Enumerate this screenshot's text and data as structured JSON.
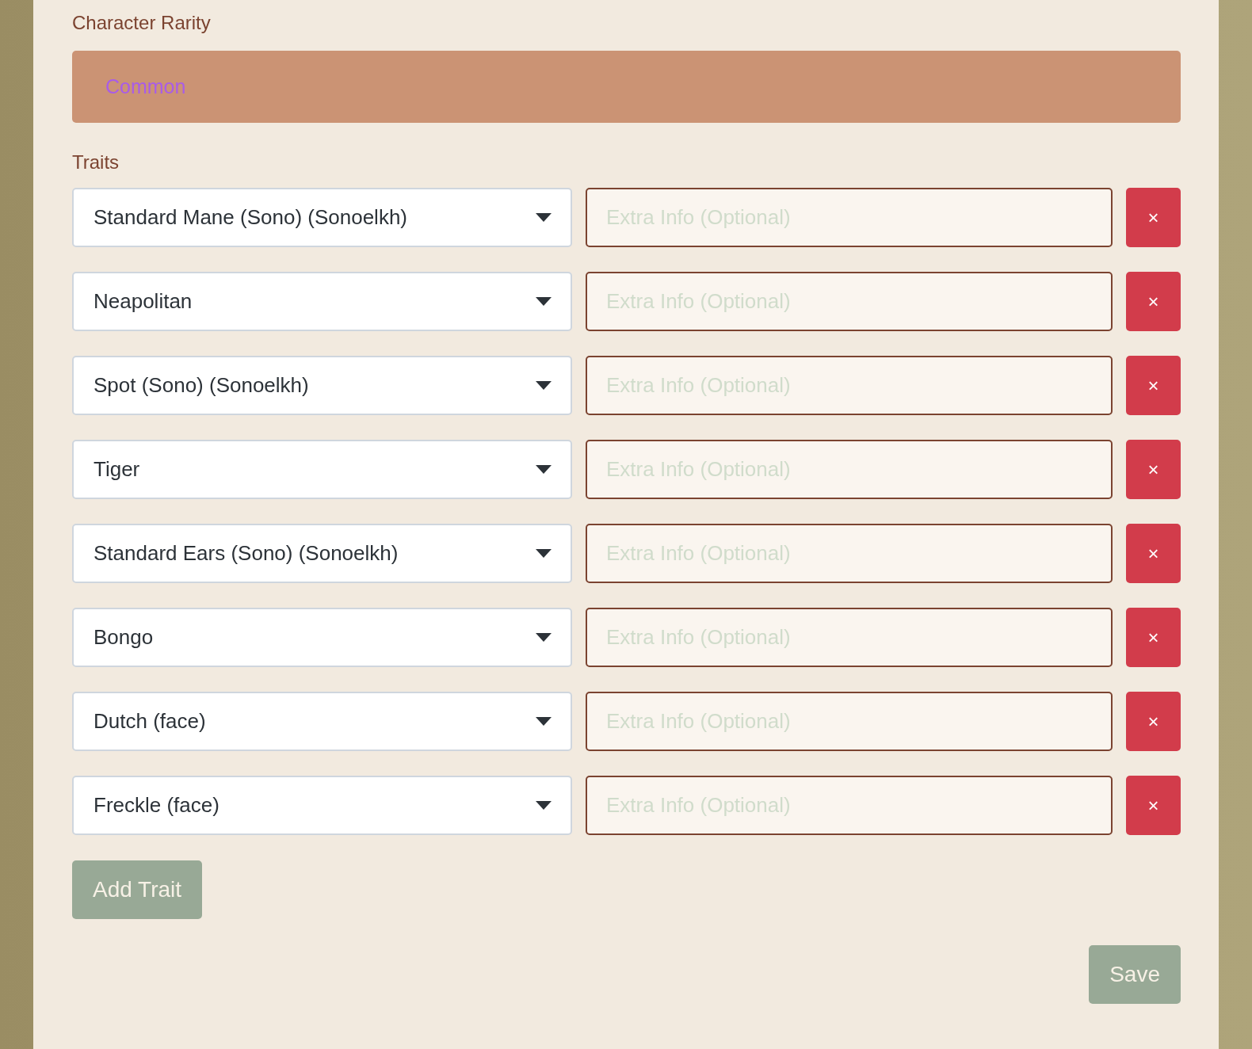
{
  "rarity": {
    "label": "Character Rarity",
    "value": "Common"
  },
  "traits": {
    "label": "Traits",
    "rows": [
      {
        "trait": "Standard Mane (Sono) (Sonoelkh)",
        "placeholder": "Extra Info (Optional)",
        "remove": "×"
      },
      {
        "trait": "Neapolitan",
        "placeholder": "Extra Info (Optional)",
        "remove": "×"
      },
      {
        "trait": "Spot (Sono) (Sonoelkh)",
        "placeholder": "Extra Info (Optional)",
        "remove": "×"
      },
      {
        "trait": "Tiger",
        "placeholder": "Extra Info (Optional)",
        "remove": "×"
      },
      {
        "trait": "Standard Ears (Sono) (Sonoelkh)",
        "placeholder": "Extra Info (Optional)",
        "remove": "×"
      },
      {
        "trait": "Bongo",
        "placeholder": "Extra Info (Optional)",
        "remove": "×"
      },
      {
        "trait": "Dutch (face)",
        "placeholder": "Extra Info (Optional)",
        "remove": "×"
      },
      {
        "trait": "Freckle (face)",
        "placeholder": "Extra Info (Optional)",
        "remove": "×"
      }
    ],
    "add_button": "Add Trait"
  },
  "save_button": "Save"
}
